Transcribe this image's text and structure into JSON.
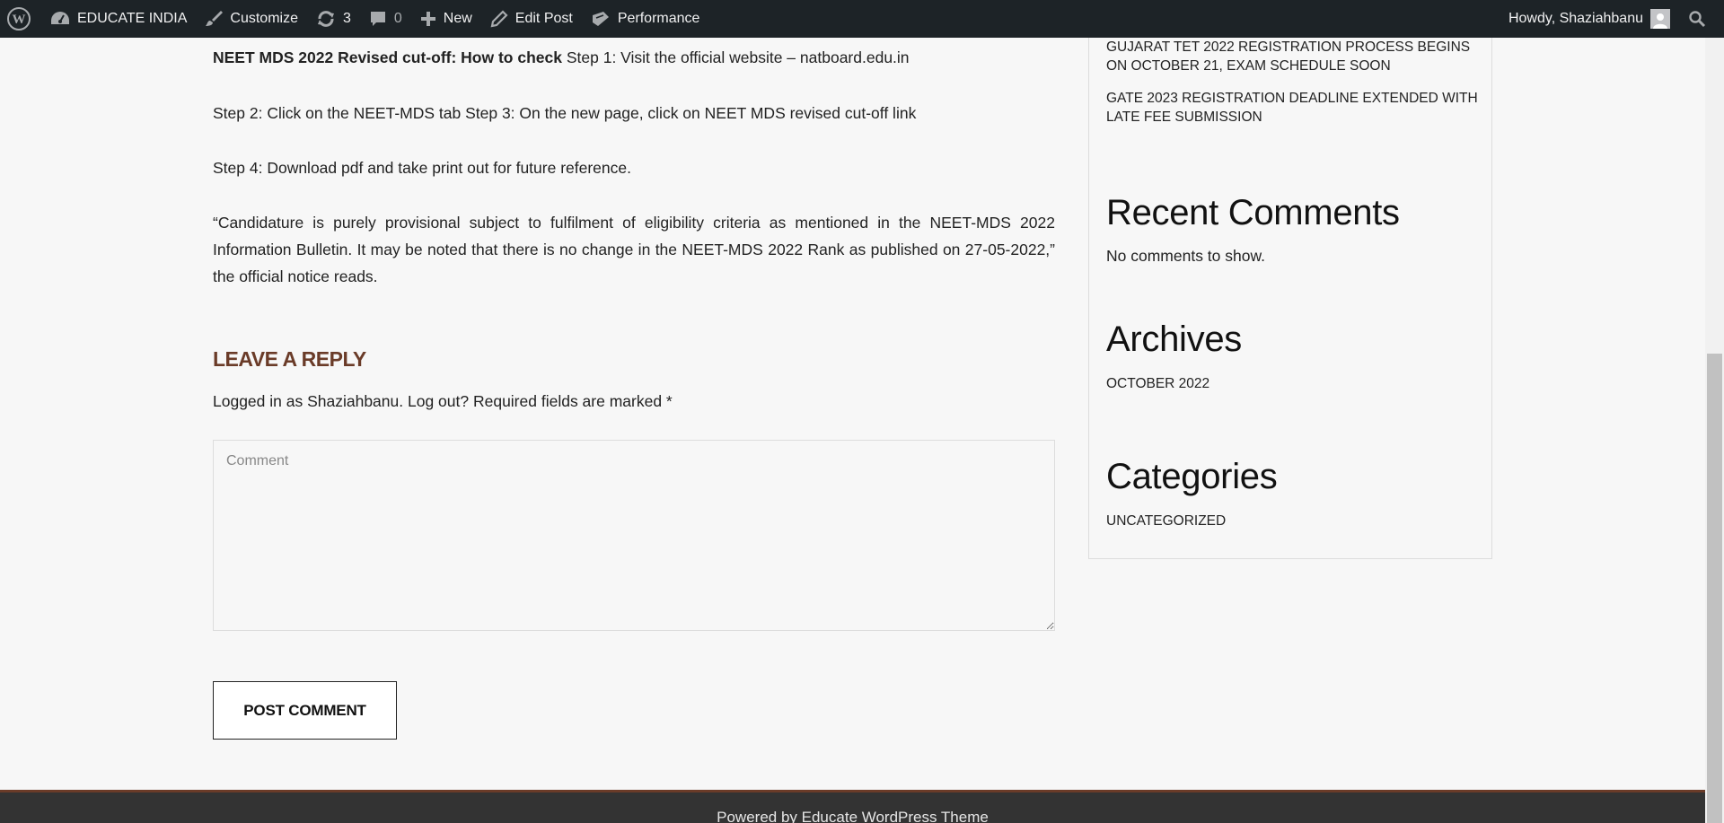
{
  "adminbar": {
    "site_name": "EDUCATE INDIA",
    "customize": "Customize",
    "updates_count": "3",
    "comments_count": "0",
    "new": "New",
    "edit_post": "Edit Post",
    "performance": "Performance",
    "howdy": "Howdy, Shaziahbanu"
  },
  "article": {
    "p1_bold": "NEET MDS 2022 Revised cut-off: How to check",
    "p1_rest": " Step 1: Visit the official website – natboard.edu.in",
    "p2": "Step 2: Click on the NEET-MDS tab Step 3: On the new page, click on NEET MDS revised cut-off link",
    "p3": "Step 4: Download pdf and take print out for future reference.",
    "p4": "“Candidature is purely provisional subject to fulfilment of eligibility criteria as mentioned in the NEET-MDS 2022 Information Bulletin. It may be noted that there is no change in the NEET-MDS 2022 Rank as published on 27-05-2022,” the official notice reads."
  },
  "reply": {
    "title": "LEAVE A REPLY",
    "logged_in": "Logged in as Shaziahbanu. Log out? Required fields are marked *",
    "comment_placeholder": "Comment",
    "submit": "POST COMMENT"
  },
  "sidebar": {
    "recent_posts": [
      "GUJARAT TET 2022 REGISTRATION PROCESS BEGINS ON OCTOBER 21, EXAM SCHEDULE SOON",
      "GATE 2023 REGISTRATION DEADLINE EXTENDED WITH LATE FEE SUBMISSION"
    ],
    "recent_comments_title": "Recent Comments",
    "no_comments": "No comments to show.",
    "archives_title": "Archives",
    "archives": [
      "OCTOBER 2022"
    ],
    "categories_title": "Categories",
    "categories": [
      "UNCATEGORIZED"
    ]
  },
  "footer": {
    "text": "Powered by Educate WordPress Theme"
  },
  "colors": {
    "adminbar_bg": "#1d2327",
    "accent_brown": "#6a3b28",
    "page_bg": "#f7f7f7",
    "footer_bg": "#333333"
  }
}
